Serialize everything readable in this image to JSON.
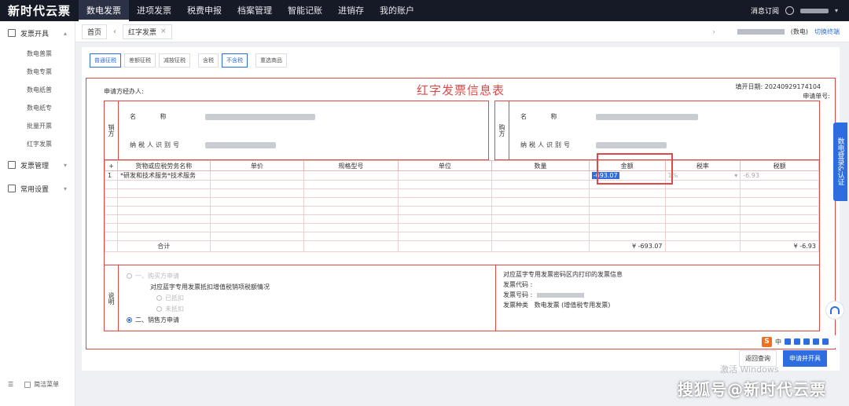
{
  "brand": "新时代云票",
  "topnav": [
    "数电发票",
    "进项发票",
    "税费申报",
    "档案管理",
    "智能记账",
    "进销存",
    "我的账户"
  ],
  "topbar_right": {
    "message": "消息订阅"
  },
  "sidebar": {
    "groups": [
      {
        "label": "发票开具",
        "items": [
          "数电普票",
          "数电专票",
          "数电纸普",
          "数电纸专",
          "批量开票",
          "红字发票"
        ]
      },
      {
        "label": "发票管理",
        "items": []
      },
      {
        "label": "常用设置",
        "items": []
      }
    ],
    "simple_menu": "简洁菜单"
  },
  "tabbar": {
    "home": "首页",
    "active": "红字发票",
    "close": "×",
    "company_suffix": "(数电)",
    "switch_terminal": "切换终端"
  },
  "filters": [
    "普通征税",
    "差额征税",
    "减按征税",
    "含税",
    "不含税",
    "重选商品"
  ],
  "form": {
    "title": "红字发票信息表",
    "applicant": "申请方经办人:",
    "fill_date": "填开日期: 20240929174104",
    "apply_no": "申请单号:",
    "seller_label": "销方",
    "buyer_label": "购方",
    "name_label": "名  称",
    "taxid_label": "纳税人识别号",
    "table": {
      "headers": [
        "+",
        "货物或应税劳务名称",
        "单价",
        "规格型号",
        "单位",
        "数量",
        "金额",
        "税率",
        "税额"
      ],
      "row": {
        "index": "1",
        "name": "*研发和技术服务*技术服务",
        "amount": "-693.07",
        "rate": "1%",
        "tax": "-6.93"
      },
      "total_label": "合计",
      "total_amount": "¥ -693.07",
      "total_tax": "¥ -6.93"
    },
    "notes": {
      "label": "说明",
      "opt_buyer": "一、购买方申请",
      "deduct_question": "对应蓝字专用发票抵扣增值税销项税额情况",
      "deducted": "已抵扣",
      "not_deducted": "未抵扣",
      "opt_seller": "二、销售方申请",
      "blue_info": "对应蓝字专用发票密码区内打印的发票信息",
      "invoice_code": "发票代码  :",
      "invoice_no": "发票号码  :",
      "invoice_type_label": "发票种类",
      "invoice_type": "数电发票 (增值税专用发票)"
    }
  },
  "actions": {
    "back": "返回查询",
    "submit": "申请并开具"
  },
  "side_float": "数电登录&认证",
  "ime": {
    "logo": "S",
    "mode": "中"
  },
  "win_watermark": "激活 Windows",
  "watermark": "搜狐号@新时代云票",
  "colors": {
    "accent": "#2e6de0",
    "highlight_red": "#e04848",
    "topbar": "#151a26"
  }
}
